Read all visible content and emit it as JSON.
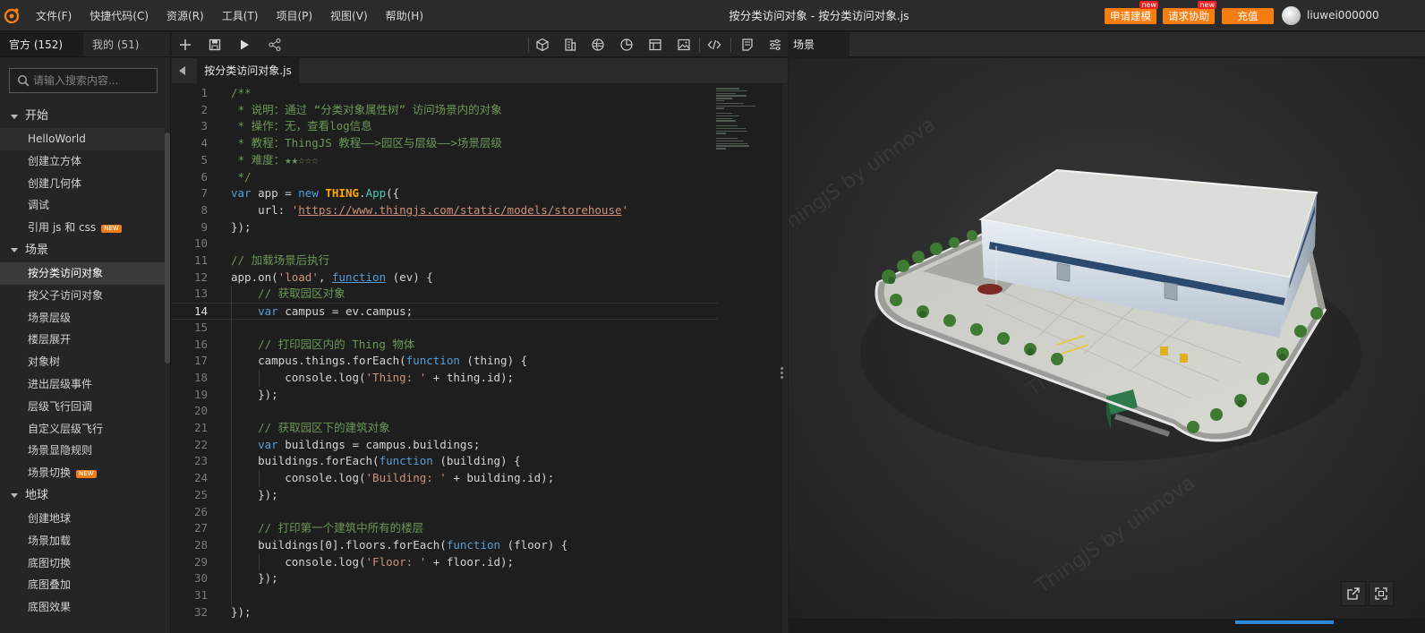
{
  "menubar": {
    "logo_icon": "thingjs-logo-icon",
    "menus": [
      "文件(F)",
      "快捷代码(C)",
      "资源(R)",
      "工具(T)",
      "项目(P)",
      "视图(V)",
      "帮助(H)"
    ],
    "window_title": "按分类访问对象 -  按分类访问对象.js",
    "buttons": {
      "modeling": "申请建模",
      "assist": "请求协助",
      "recharge": "充值",
      "new_tag": "new"
    },
    "username": "liuwei000000",
    "accent_color": "#f77d10"
  },
  "left_panel": {
    "tabs": {
      "official": "官方 (152)",
      "mine": "我的 (51)"
    },
    "search_placeholder": "请输入搜索内容...",
    "sections": [
      {
        "title": "开始",
        "items": [
          {
            "label": "HelloWorld"
          },
          {
            "label": "创建立方体"
          },
          {
            "label": "创建几何体"
          },
          {
            "label": "调试"
          },
          {
            "label": "引用 js 和 css",
            "badge": "NEW"
          }
        ]
      },
      {
        "title": "场景",
        "items": [
          {
            "label": "按分类访问对象",
            "active": true
          },
          {
            "label": "按父子访问对象"
          },
          {
            "label": "场景层级"
          },
          {
            "label": "楼层展开"
          },
          {
            "label": "对象树"
          },
          {
            "label": "进出层级事件"
          },
          {
            "label": "层级飞行回调"
          },
          {
            "label": "自定义层级飞行"
          },
          {
            "label": "场景显隐规则"
          },
          {
            "label": "场景切换",
            "badge": "NEW"
          }
        ]
      },
      {
        "title": "地球",
        "items": [
          {
            "label": "创建地球"
          },
          {
            "label": "场景加载"
          },
          {
            "label": "底图切换"
          },
          {
            "label": "底图叠加"
          },
          {
            "label": "底图效果"
          }
        ]
      }
    ]
  },
  "editor": {
    "toolbar_icons": [
      "add-icon",
      "save-icon",
      "run-icon",
      "share-icon",
      "cube-icon",
      "building-icon",
      "globe-icon",
      "pie-chart-icon",
      "layout-icon",
      "image-icon",
      "code-icon",
      "notes-icon",
      "settings-icon"
    ],
    "tab_label": "按分类访问对象.js",
    "current_line": 14,
    "lines": [
      [
        {
          "t": "/**",
          "c": "com"
        }
      ],
      [
        {
          "t": " * 说明：通过 “分类对象属性树” 访问场景内的对象",
          "c": "com"
        }
      ],
      [
        {
          "t": " * 操作：无，查看log信息",
          "c": "com"
        }
      ],
      [
        {
          "t": " * 教程：ThingJS 教程——>园区与层级——>场景层级",
          "c": "com"
        }
      ],
      [
        {
          "t": " * 难度：★★☆☆☆",
          "c": "com"
        }
      ],
      [
        {
          "t": " */",
          "c": "com"
        }
      ],
      [
        {
          "t": "var",
          "c": "kw"
        },
        {
          "t": " app = "
        },
        {
          "t": "new",
          "c": "kw"
        },
        {
          "t": " "
        },
        {
          "t": "THING",
          "c": "thing"
        },
        {
          "t": "."
        },
        {
          "t": "App",
          "c": "cls"
        },
        {
          "t": "({"
        }
      ],
      [
        {
          "t": "    url: "
        },
        {
          "t": "'",
          "c": "str"
        },
        {
          "t": "https://www.thingjs.com/static/models/storehouse",
          "c": "url"
        },
        {
          "t": "'",
          "c": "str"
        }
      ],
      [
        {
          "t": "});"
        }
      ],
      [
        {
          "t": ""
        }
      ],
      [
        {
          "t": "// 加载场景后执行",
          "c": "com"
        }
      ],
      [
        {
          "t": "app.on("
        },
        {
          "t": "'load'",
          "c": "str"
        },
        {
          "t": ", "
        },
        {
          "t": "function",
          "c": "fn"
        },
        {
          "t": " (ev) {"
        }
      ],
      [
        {
          "t": "    "
        },
        {
          "t": "// 获取园区对象",
          "c": "com"
        }
      ],
      [
        {
          "t": "    "
        },
        {
          "t": "var",
          "c": "kw"
        },
        {
          "t": " campus = ev.campus;"
        }
      ],
      [
        {
          "t": ""
        }
      ],
      [
        {
          "t": "    "
        },
        {
          "t": "// 打印园区内的 Thing 物体",
          "c": "com"
        }
      ],
      [
        {
          "t": "    campus.things.forEach("
        },
        {
          "t": "function",
          "c": "kw"
        },
        {
          "t": " (thing) {"
        }
      ],
      [
        {
          "t": "        console.log("
        },
        {
          "t": "'Thing: '",
          "c": "str"
        },
        {
          "t": " + thing.id);"
        }
      ],
      [
        {
          "t": "    });"
        }
      ],
      [
        {
          "t": ""
        }
      ],
      [
        {
          "t": "    "
        },
        {
          "t": "// 获取园区下的建筑对象",
          "c": "com"
        }
      ],
      [
        {
          "t": "    "
        },
        {
          "t": "var",
          "c": "kw"
        },
        {
          "t": " buildings = campus.buildings;"
        }
      ],
      [
        {
          "t": "    buildings.forEach("
        },
        {
          "t": "function",
          "c": "kw"
        },
        {
          "t": " (building) {"
        }
      ],
      [
        {
          "t": "        console.log("
        },
        {
          "t": "'Building: '",
          "c": "str"
        },
        {
          "t": " + building.id);"
        }
      ],
      [
        {
          "t": "    });"
        }
      ],
      [
        {
          "t": ""
        }
      ],
      [
        {
          "t": "    "
        },
        {
          "t": "// 打印第一个建筑中所有的楼层",
          "c": "com"
        }
      ],
      [
        {
          "t": "    buildings[0].floors.forEach("
        },
        {
          "t": "function",
          "c": "kw"
        },
        {
          "t": " (floor) {"
        }
      ],
      [
        {
          "t": "        console.log("
        },
        {
          "t": "'Floor: '",
          "c": "str"
        },
        {
          "t": " + floor.id);"
        }
      ],
      [
        {
          "t": "    });"
        }
      ],
      [
        {
          "t": ""
        }
      ],
      [
        {
          "t": "});"
        }
      ]
    ]
  },
  "scene": {
    "tab_label": "场景",
    "watermark": "ThingJS by uinnova",
    "buttons": [
      "external-link-icon",
      "fullscreen-icon"
    ]
  }
}
